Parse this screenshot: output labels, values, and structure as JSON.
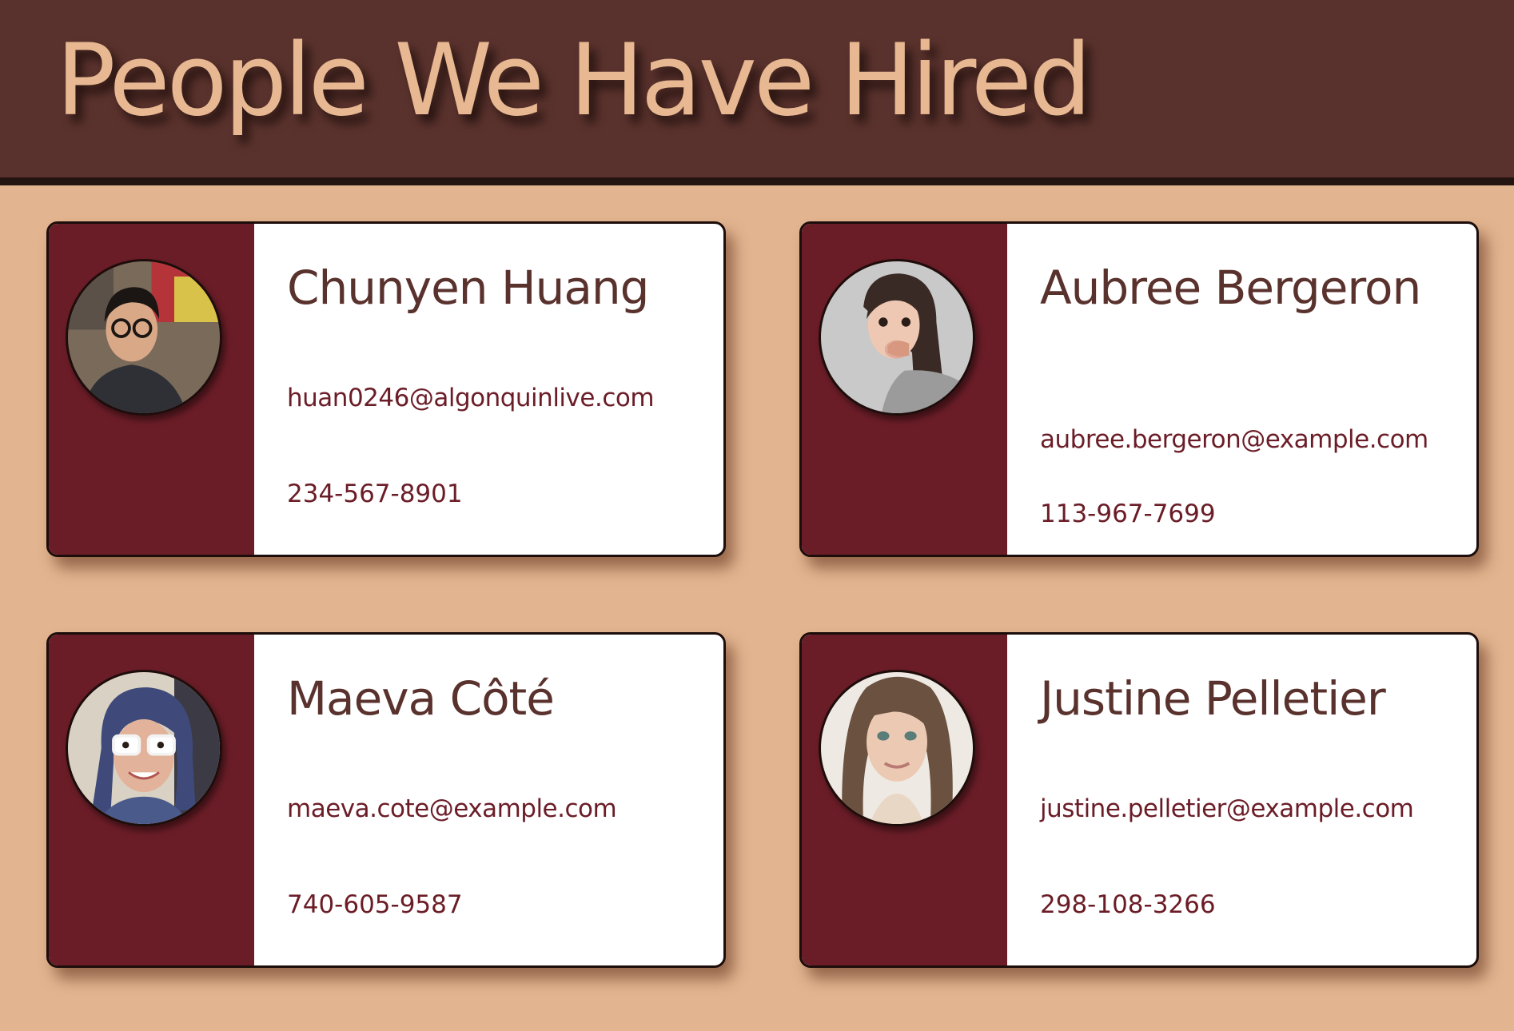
{
  "header": {
    "title": "People We Have Hired"
  },
  "colors": {
    "page_background": "#e2b48f",
    "header_background": "#5a322d",
    "title_color": "#e7b891",
    "card_sidebar": "#6b1d27",
    "name_color": "#5a322d",
    "contact_color": "#6b1d27"
  },
  "people": [
    {
      "name": "Chunyen Huang",
      "email": "huan0246@algonquinlive.com",
      "phone": "234-567-8901",
      "avatar": "avatar-photo"
    },
    {
      "name": "Aubree Bergeron",
      "email": "aubree.bergeron@example.com",
      "phone": "113-967-7699",
      "avatar": "avatar-photo"
    },
    {
      "name": "Maeva Côté",
      "email": "maeva.cote@example.com",
      "phone": "740-605-9587",
      "avatar": "avatar-photo"
    },
    {
      "name": "Justine Pelletier",
      "email": "justine.pelletier@example.com",
      "phone": "298-108-3266",
      "avatar": "avatar-photo"
    }
  ]
}
